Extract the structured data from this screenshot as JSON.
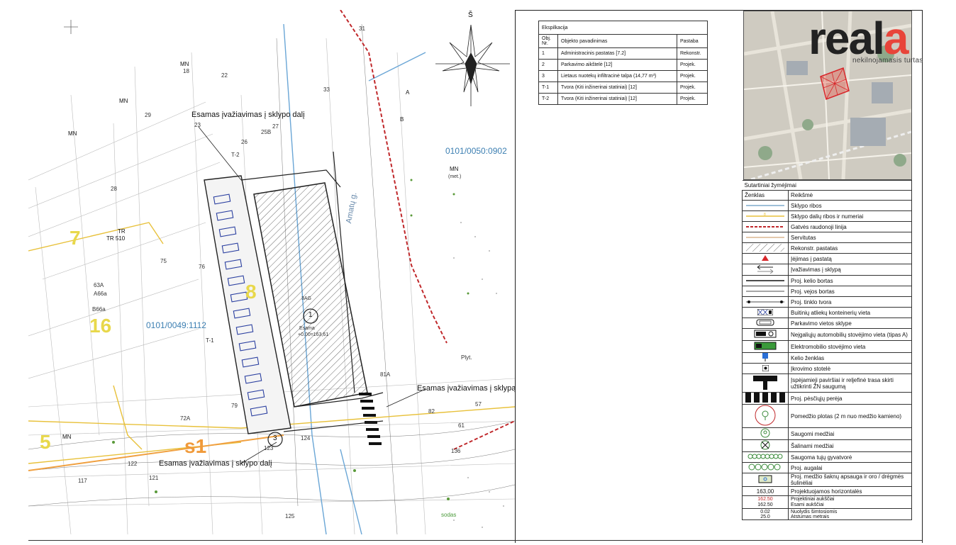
{
  "sheet": {
    "plan_labels": {
      "north_mark": "Š",
      "cadastral_1": "0101/0050:0902",
      "cadastral_2": "0101/0049:1112",
      "entrance_top": "Esamas įvažiavimas į sklypo dalį",
      "entrance_right": "Esamas įvažiavimas į sklypą",
      "entrance_bottom": "Esamas įvažiavimas į sklypo dalį",
      "street_1": "Amatų g.",
      "street_2": "Plyt.",
      "building_mark": "Esama",
      "building_level": "+0.00=163,61",
      "building_note": "3AG",
      "callout_1": "1",
      "callout_3": "3",
      "fence_t1": "T-1",
      "fence_t2": "T-2",
      "zone_7": "7",
      "zone_8": "8",
      "zone_16": "16",
      "zone_5": "5",
      "zone_s1": "s1",
      "mn_1": "MN",
      "mn_2": "MN",
      "mn_3": "MN",
      "mn_4": "MN",
      "mn_met": "MN",
      "mn_met_sub": "(met.)",
      "tr": "TR",
      "tr_510": "TR 510",
      "label_a": "A",
      "label_b": "B",
      "label_sodas": "sodas",
      "lot_numbers": [
        "23",
        "25B",
        "27",
        "26",
        "28",
        "29",
        "22",
        "18",
        "31",
        "33",
        "75",
        "76",
        "63A",
        "A66a",
        "B66a",
        "72A",
        "79",
        "81A",
        "82",
        "121",
        "122",
        "123",
        "124",
        "125",
        "117",
        "136",
        "57",
        "61"
      ]
    },
    "explication": {
      "title": "Ekspilkacija",
      "headers": [
        "Obj. Nr.",
        "Objekto pavadinimas",
        "Pastaba"
      ],
      "rows": [
        [
          "1",
          "Administracinis pastatas [7.2]",
          "Rekonstr."
        ],
        [
          "2",
          "Parkavimo aikštelė [12]",
          "Projek."
        ],
        [
          "3",
          "Lietaus nuotekų infiltracinė talpa (14,77 m³)",
          "Projek."
        ],
        [
          "T-1",
          "Tvora (Kiti inžinerinai statiniai) [12]",
          "Projek."
        ],
        [
          "T-2",
          "Tvora (Kiti inžinerinai statiniai) [12]",
          "Projek."
        ]
      ]
    },
    "brand": {
      "word_main": "real",
      "word_accent": "a",
      "tagline": "nekilnojamasis turtas"
    },
    "legend": {
      "title": "Sutartiniai žymėjimai",
      "col_symbol": "Ženklas",
      "col_meaning": "Reikšmė",
      "items": [
        {
          "icon": "lot-boundary-line",
          "label": "Sklypo ribos"
        },
        {
          "icon": "lot-part-boundary-line",
          "label": "Sklypo dalių ribos ir numeriai"
        },
        {
          "icon": "red-line",
          "label": "Gatvės raudonoji linija"
        },
        {
          "icon": "servitude-line",
          "label": "Servitutas"
        },
        {
          "icon": "hatch-icon",
          "label": "Rekonstr. pastatas"
        },
        {
          "icon": "entrance-triangle-icon",
          "label": "Įėjimas į pastatą"
        },
        {
          "icon": "entry-arrows-icon",
          "label": "Įvažiavimas į sklypą"
        },
        {
          "icon": "road-edge-line",
          "label": "Proj. kelio bortas"
        },
        {
          "icon": "lawn-edge-line",
          "label": "Proj. vejos bortas"
        },
        {
          "icon": "mesh-fence-line",
          "label": "Proj. tinklo tvora"
        },
        {
          "icon": "container-icon",
          "label": "Buitinių atliekų konteinerių vieta"
        },
        {
          "icon": "parking-icon",
          "label": "Parkavimo vietos sklype"
        },
        {
          "icon": "disabled-parking-icon",
          "label": "Neįgaliųjų automobilių stovėjimo vieta (tipas A)"
        },
        {
          "icon": "ev-parking-icon",
          "label": "Elektromobilio stovėjimo vieta"
        },
        {
          "icon": "road-sign-icon",
          "label": "Kelio ženklas"
        },
        {
          "icon": "charging-post-icon",
          "label": "Įkrovimo stotelė"
        },
        {
          "icon": "tactile-surface-icon",
          "label": "Įspėjamieji paviršiai ir reljefinė trasa skirti užtikrinti ŽN saugumą"
        },
        {
          "icon": "crosswalk-icon",
          "label": "Proj. pėsčiųjų perėja"
        },
        {
          "icon": "tree-zone-icon",
          "label": "Pomedžio plotas (2 m nuo medžio kamieno)"
        },
        {
          "icon": "kept-tree-icon",
          "label": "Saugomi medžiai"
        },
        {
          "icon": "removed-tree-icon",
          "label": "Šalinami medžiai"
        },
        {
          "icon": "thuja-row-icon",
          "label": "Saugoma tujų gyvatvorė"
        },
        {
          "icon": "shrub-icon",
          "label": "Proj. augalai"
        },
        {
          "icon": "root-protection-icon",
          "label": "Proj. medžio šaknų apsauga ir oro / drėgmės šulinėliai"
        },
        {
          "icon": "contour-value",
          "symbol_text": "163,00",
          "label": "Projektuojamos horizontalės"
        },
        {
          "icon": "levels-value",
          "symbol_text_1": "162.50",
          "symbol_text_2": "162.50",
          "label_1": "Projektiniai aukščiai",
          "label_2": "Esami aukščiai"
        },
        {
          "icon": "slope-value",
          "symbol_text_1": "0.02",
          "symbol_text_2": "25.0",
          "label_1": "Nuolydis šimtosiomis",
          "label_2": "Atstumas metrais"
        }
      ]
    },
    "colors": {
      "red_line": "#c0282b",
      "zone_yellow": "#e8d84b",
      "cadastral_blue": "#3c7fb2",
      "brand_red": "#e8443a",
      "water_blue": "#6aa6d6",
      "parking_blue": "#2a3fa0"
    }
  }
}
